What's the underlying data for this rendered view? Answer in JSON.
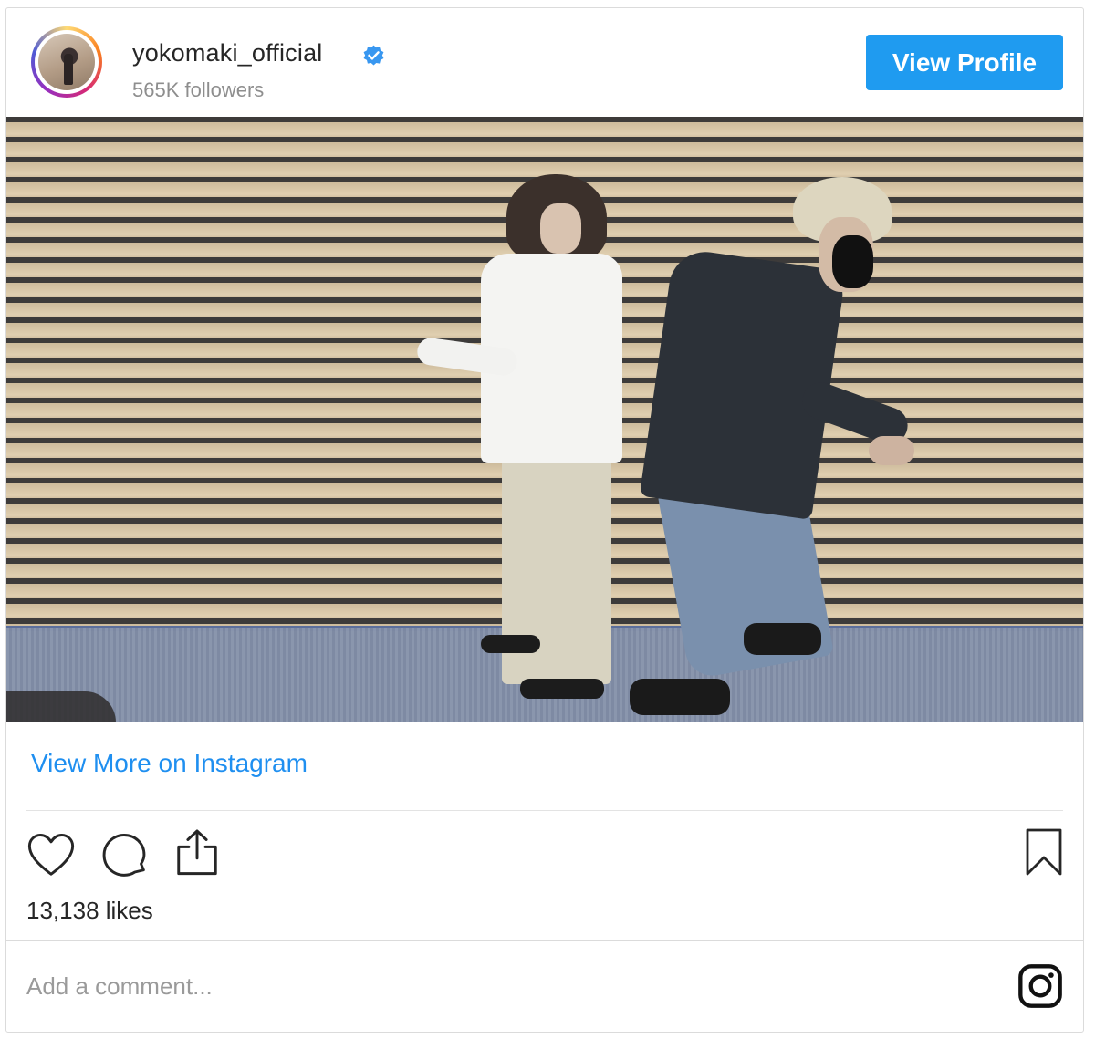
{
  "header": {
    "username": "yokomaki_official",
    "verified": true,
    "followers": "565K followers",
    "view_profile_label": "View Profile"
  },
  "post": {
    "media_type": "video",
    "view_more_label": "View More on Instagram",
    "likes": "13,138 likes"
  },
  "actions": {
    "icons": [
      "heart-icon",
      "comment-icon",
      "share-icon",
      "bookmark-icon"
    ]
  },
  "comment": {
    "placeholder": "Add a comment..."
  },
  "footer": {
    "logo_icon": "instagram-icon"
  },
  "colors": {
    "accent": "#1f9bf0",
    "link": "#1f8ff0",
    "muted": "#8e8e8e",
    "verified": "#3897f0"
  }
}
